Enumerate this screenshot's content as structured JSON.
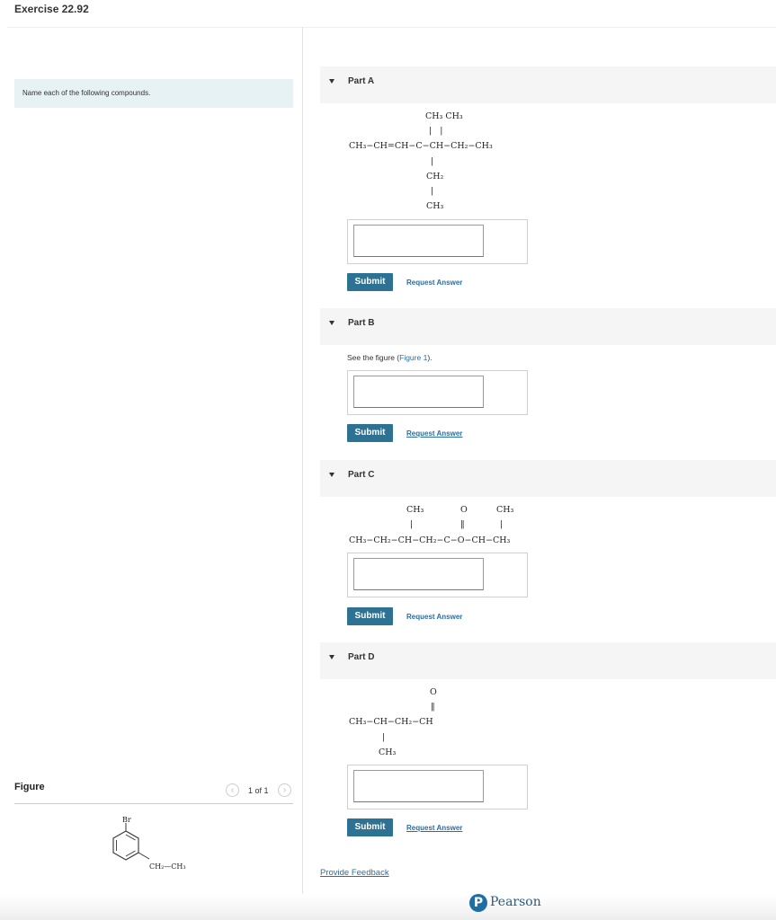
{
  "page": {
    "title": "Exercise 22.92"
  },
  "prompt": {
    "text": "Name each of the following compounds."
  },
  "parts": [
    {
      "label": "Part A",
      "structure": {
        "top_line": "CH₃ CH₃",
        "bonds_top": "|   |",
        "main_chain": "CH₃−CH=CH−C−CH−CH₂−CH₃",
        "bond_mid": "|",
        "branch1": "CH₂",
        "bond_low": "|",
        "branch2": "CH₃"
      },
      "answer_value": "",
      "submit_label": "Submit",
      "request_label": "Request Answer"
    },
    {
      "label": "Part B",
      "text_prefix": "See the figure (",
      "figure_link": "Figure 1",
      "text_suffix": ").",
      "answer_value": "",
      "submit_label": "Submit",
      "request_label": "Request Answer"
    },
    {
      "label": "Part C",
      "structure": {
        "top_left": "CH₃",
        "top_mid": "O",
        "top_right": "CH₃",
        "bond_left": "|",
        "bond_mid": "‖",
        "bond_right": "|",
        "main_chain": "CH₃−CH₂−CH−CH₂−C−O−CH−CH₃"
      },
      "answer_value": "",
      "submit_label": "Submit",
      "request_label": "Request Answer"
    },
    {
      "label": "Part D",
      "structure": {
        "top": "O",
        "bond_top": "‖",
        "main_chain": "CH₃−CH−CH₂−CH",
        "bond_low": "|",
        "branch": "CH₃"
      },
      "answer_value": "",
      "submit_label": "Submit",
      "request_label": "Request Answer"
    }
  ],
  "figure": {
    "label": "Figure",
    "prev_icon": "‹",
    "next_icon": "›",
    "count": "1 of 1",
    "structure": {
      "substituent_top": "Br",
      "substituent_side": "CH₂—CH₃"
    }
  },
  "footer": {
    "feedback_link": "Provide Feedback",
    "logo_letter": "P",
    "brand": "Pearson",
    "brand_color": "#1c6fa3"
  },
  "colors": {
    "accent": "#2d7293",
    "link": "#2a6ea4",
    "prompt_bg": "#e7f2f4"
  },
  "icons": {
    "collapse": "triangle-down-icon"
  }
}
